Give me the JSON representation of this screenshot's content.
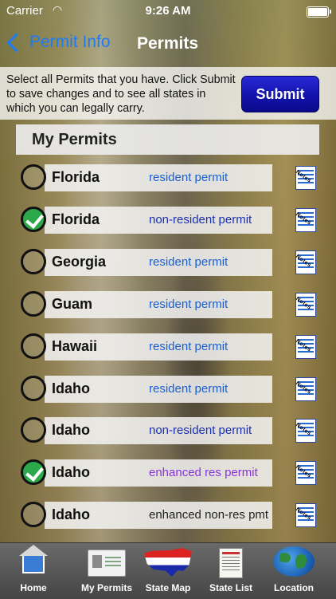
{
  "status_bar": {
    "carrier": "Carrier",
    "time": "9:26 AM"
  },
  "nav": {
    "back_label": "Permit Info",
    "title": "Permits"
  },
  "instructions": "Select all Permits that you have.  Click Submit to save changes and to see all states in which you can legally carry.",
  "submit_label": "Submit",
  "section_header": "My Permits",
  "rows": [
    {
      "state": "Florida",
      "permit": "resident permit",
      "checked": false,
      "color": "#1a5fd0"
    },
    {
      "state": "Florida",
      "permit": "non-resident permit",
      "checked": true,
      "color": "#1c2fb0"
    },
    {
      "state": "Georgia",
      "permit": "resident permit",
      "checked": false,
      "color": "#1a5fd0"
    },
    {
      "state": "Guam",
      "permit": "resident permit",
      "checked": false,
      "color": "#1a5fd0"
    },
    {
      "state": "Hawaii",
      "permit": "resident permit",
      "checked": false,
      "color": "#1a5fd0"
    },
    {
      "state": "Idaho",
      "permit": "resident permit",
      "checked": false,
      "color": "#1a5fd0"
    },
    {
      "state": "Idaho",
      "permit": "non-resident permit",
      "checked": false,
      "color": "#1c2fb0"
    },
    {
      "state": "Idaho",
      "permit": "enhanced res permit",
      "checked": true,
      "color": "#8a33d8"
    },
    {
      "state": "Idaho",
      "permit": "enhanced non-res pmt",
      "checked": false,
      "color": "#222222"
    }
  ],
  "notes_icon_text": "Notes",
  "tabs": [
    {
      "label": "Home",
      "icon": "home-icon"
    },
    {
      "label": "My Permits",
      "icon": "permit-card-icon"
    },
    {
      "label": "State Map",
      "icon": "us-map-icon"
    },
    {
      "label": "State List",
      "icon": "state-list-icon"
    },
    {
      "label": "Location",
      "icon": "globe-icon"
    }
  ]
}
